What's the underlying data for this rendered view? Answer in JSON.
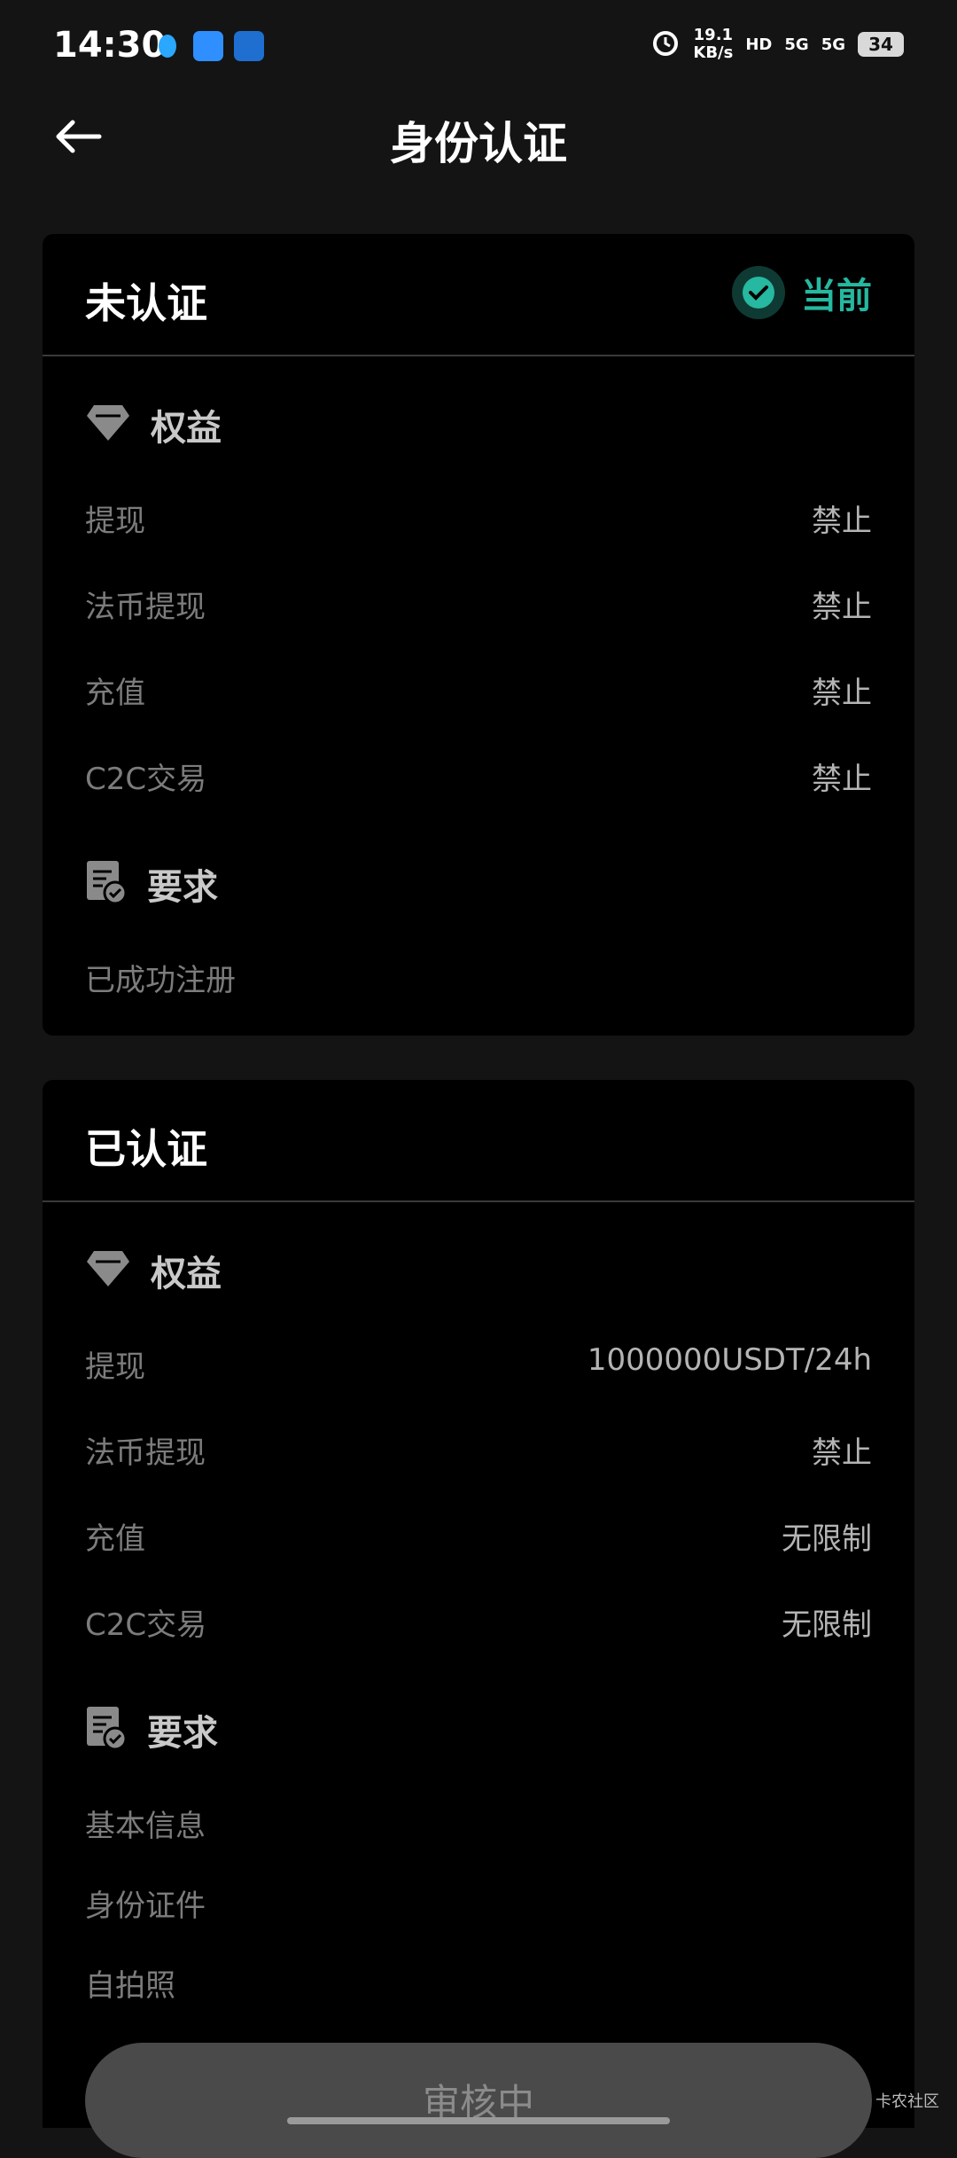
{
  "status_bar": {
    "time": "14:30",
    "notification_icons": [
      "qq-icon",
      "app-icon",
      "app-icon-2"
    ],
    "alarm_icon": "alarm-icon",
    "net_speed_value": "19.1",
    "net_speed_unit": "KB/s",
    "hd_badge": "HD",
    "signal_1": "5G",
    "signal_2": "5G",
    "battery": "34"
  },
  "header": {
    "back_icon": "arrow-left-icon",
    "title": "身份认证"
  },
  "cards": [
    {
      "title": "未认证",
      "current_label": "当前",
      "benefits_title": "权益",
      "benefits": [
        {
          "label": "提现",
          "value": "禁止"
        },
        {
          "label": "法币提现",
          "value": "禁止"
        },
        {
          "label": "充值",
          "value": "禁止"
        },
        {
          "label": "C2C交易",
          "value": "禁止"
        }
      ],
      "requirements_title": "要求",
      "requirements": [
        "已成功注册"
      ]
    },
    {
      "title": "已认证",
      "benefits_title": "权益",
      "benefits": [
        {
          "label": "提现",
          "value": "1000000USDT/24h"
        },
        {
          "label": "法币提现",
          "value": "禁止"
        },
        {
          "label": "充值",
          "value": "无限制"
        },
        {
          "label": "C2C交易",
          "value": "无限制"
        }
      ],
      "requirements_title": "要求",
      "requirements": [
        "基本信息",
        "身份证件",
        "自拍照"
      ],
      "button_label": "审核中"
    }
  ],
  "watermark": "卡农社区",
  "colors": {
    "background": "#141414",
    "card": "#000000",
    "accent": "#26b8a0"
  }
}
